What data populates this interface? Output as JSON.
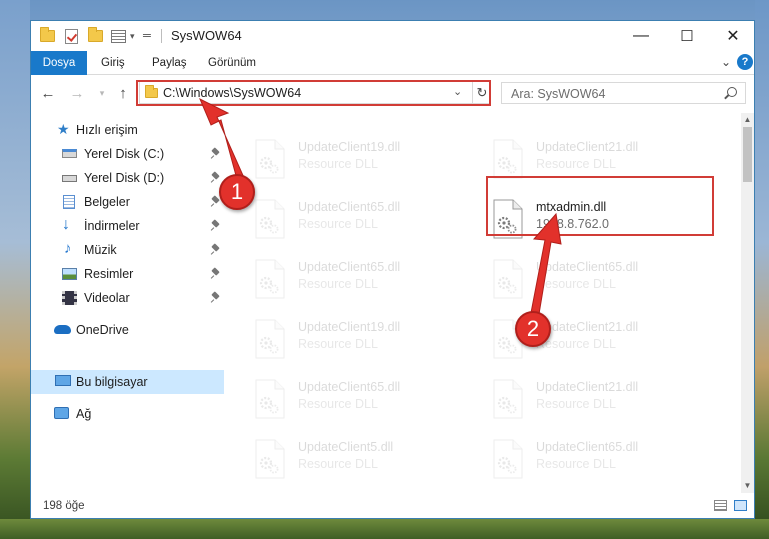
{
  "window": {
    "title": "SysWOW64",
    "controls": {
      "minimize": "—",
      "maximize": "☐",
      "close": "✕"
    }
  },
  "ribbon": {
    "tabs": [
      "Dosya",
      "Giriş",
      "Paylaş",
      "Görünüm"
    ],
    "help": "?"
  },
  "address": {
    "path": "C:\\Windows\\SysWOW64",
    "search_placeholder": "Ara: SysWOW64"
  },
  "sidebar": {
    "items": [
      {
        "label": "Hızlı erişim",
        "icon": "star-icon",
        "pinned": false
      },
      {
        "label": "Yerel Disk (C:)",
        "icon": "drive-icon",
        "pinned": true
      },
      {
        "label": "Yerel Disk (D:)",
        "icon": "drive-icon",
        "pinned": true
      },
      {
        "label": "Belgeler",
        "icon": "documents-icon",
        "pinned": true
      },
      {
        "label": "İndirmeler",
        "icon": "download-icon",
        "pinned": true
      },
      {
        "label": "Müzik",
        "icon": "music-icon",
        "pinned": true
      },
      {
        "label": "Resimler",
        "icon": "pictures-icon",
        "pinned": true
      },
      {
        "label": "Videolar",
        "icon": "videos-icon",
        "pinned": true
      },
      {
        "label": "OneDrive",
        "icon": "cloud-icon",
        "pinned": false
      },
      {
        "label": "Bu bilgisayar",
        "icon": "computer-icon",
        "pinned": false,
        "selected": true
      },
      {
        "label": "Ağ",
        "icon": "network-icon",
        "pinned": false
      }
    ]
  },
  "files": [
    {
      "name": "UpdateClient19.dll",
      "desc": "Resource DLL",
      "faded": true
    },
    {
      "name": "UpdateClient21.dll",
      "desc": "Resource DLL",
      "faded": true
    },
    {
      "name": "UpdateClient65.dll",
      "desc": "Resource DLL",
      "faded": true
    },
    {
      "name": "mtxadmin.dll",
      "desc": "1998.8.762.0",
      "faded": false
    },
    {
      "name": "UpdateClient65.dll",
      "desc": "Resource DLL",
      "faded": true
    },
    {
      "name": "UpdateClient65.dll",
      "desc": "Resource DLL",
      "faded": true
    },
    {
      "name": "UpdateClient19.dll",
      "desc": "Resource DLL",
      "faded": true
    },
    {
      "name": "UpdateClient21.dll",
      "desc": "Resource DLL",
      "faded": true
    },
    {
      "name": "UpdateClient65.dll",
      "desc": "Resource DLL",
      "faded": true
    },
    {
      "name": "UpdateClient21.dll",
      "desc": "Resource DLL",
      "faded": true
    },
    {
      "name": "UpdateClient5.dll",
      "desc": "Resource DLL",
      "faded": true
    },
    {
      "name": "UpdateClient65.dll",
      "desc": "Resource DLL",
      "faded": true
    }
  ],
  "status": {
    "count": "198 öğe"
  },
  "annotations": [
    {
      "number": "1"
    },
    {
      "number": "2"
    }
  ],
  "colors": {
    "accent": "#1979ca",
    "highlight": "#d13c36",
    "badge": "#e2312b"
  }
}
